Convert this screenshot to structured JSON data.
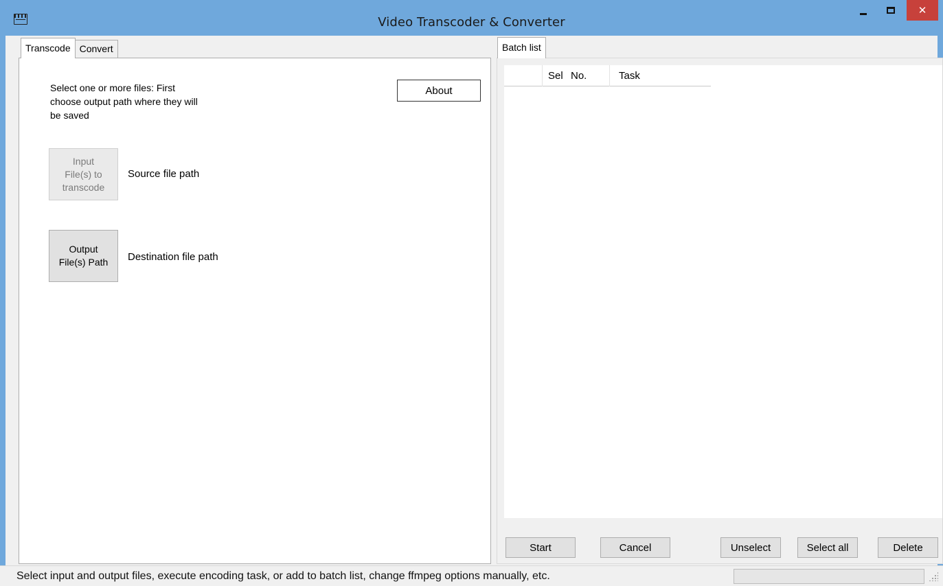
{
  "window": {
    "title": "Video Transcoder & Converter",
    "minimize_icon": "minimize-icon",
    "maximize_icon": "maximize-icon",
    "close_glyph": "✕",
    "titlebar_color": "#6fa8dc",
    "close_color": "#c7413b"
  },
  "left_tabs": [
    {
      "label": "Transcode",
      "active": true
    },
    {
      "label": "Convert",
      "active": false
    }
  ],
  "transcode": {
    "instructions": "Select one or more files: First choose output path where they will be saved",
    "about_label": "About",
    "input_button": {
      "line1": "Input",
      "line2": "File(s) to",
      "line3": "transcode",
      "enabled": false
    },
    "source_label": "Source file path",
    "output_button": {
      "line1": "Output",
      "line2": "File(s) Path"
    },
    "dest_label": "Destination file path"
  },
  "batch": {
    "tab_label": "Batch list",
    "columns": {
      "sel": "Sel",
      "no": "No.",
      "task": "Task"
    },
    "rows": [],
    "buttons": {
      "start": "Start",
      "cancel": "Cancel",
      "unselect": "Unselect",
      "select_all": "Select all",
      "delete": "Delete"
    }
  },
  "status": {
    "text": "Select input and output files, execute encoding task, or add to batch list, change ffmpeg options manually, etc.",
    "progress_fraction": 0
  }
}
